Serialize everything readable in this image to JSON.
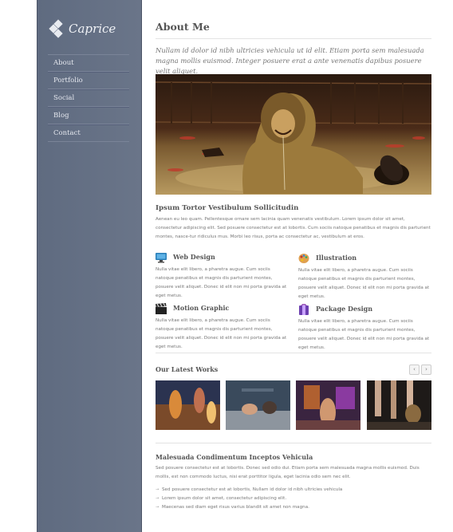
{
  "brand": {
    "name": "Caprice"
  },
  "nav": {
    "items": [
      {
        "label": "About"
      },
      {
        "label": "Portfolio"
      },
      {
        "label": "Social"
      },
      {
        "label": "Blog"
      },
      {
        "label": "Contact"
      }
    ]
  },
  "page": {
    "title": "About Me",
    "intro": "Nullam id dolor id nibh ultricies vehicula ut id elit. Etiam porta sem malesuada magna mollis euismod. Integer posuere erat a ante venenatis dapibus posuere velit aliquet.",
    "section_heading": "Ipsum Tortor Vestibulum Sollicitudin",
    "section_text": "Aenean eu leo quam. Pellentesque ornare sem lacinia quam venenatis vestibulum. Lorem ipsum dolor sit amet, consectetur adipiscing elit. Sed posuere consectetur est at lobortis. Cum sociis natoque penatibus et magnis dis parturient montes, nasce-tur ridiculus mus. Morbi leo risus, porta ac consectetur ac, vestibulum at eros."
  },
  "features": [
    {
      "title": "Web Design",
      "icon": "monitor-icon",
      "text": "Nulla vitae elit libero, a pharetra augue. Cum sociis natoque penatibus et magnis dis parturient montes, posuere velit aliquet. Donec id elit non mi porta gravida at eget metus."
    },
    {
      "title": "Illustration",
      "icon": "palette-icon",
      "text": "Nulla vitae elit libero, a pharetra augue. Cum sociis natoque penatibus et magnis dis parturient montes, posuere velit aliquet. Donec id elit non mi porta gravida at eget metus."
    },
    {
      "title": "Motion Graphic",
      "icon": "clapperboard-icon",
      "text": "Nulla vitae elit libero, a pharetra augue. Cum sociis natoque penatibus et magnis dis parturient montes, posuere velit aliquet. Donec id elit non mi porta gravida at eget metus."
    },
    {
      "title": "Package Design",
      "icon": "box-icon",
      "text": "Nulla vitae elit libero, a pharetra augue. Cum sociis natoque penatibus et magnis dis parturient montes, posuere velit aliquet. Donec id elit non mi porta gravida at eget metus."
    }
  ],
  "works": {
    "heading": "Our Latest Works",
    "prev": "‹",
    "next": "›"
  },
  "footer_section": {
    "heading": "Malesuada Condimentum Inceptos Vehicula",
    "text": "Sed posuere consectetur est at lobortis. Donec sed odio dui. Etiam porta sem malesuada magna mollis euismod. Duis mollis, est non commodo luctus, nisi erat porttitor ligula, eget lacinia odio sem nec elit.",
    "bullets": [
      "Sed posuere consectetur est at lobortis, Nullam id dolor id nibh ultricies vehicula",
      "Lorem ipsum dolor sit amet, consectetur adipiscing elit.",
      "Maecenas sed diam eget risus varius blandit sit amet non magna."
    ]
  }
}
